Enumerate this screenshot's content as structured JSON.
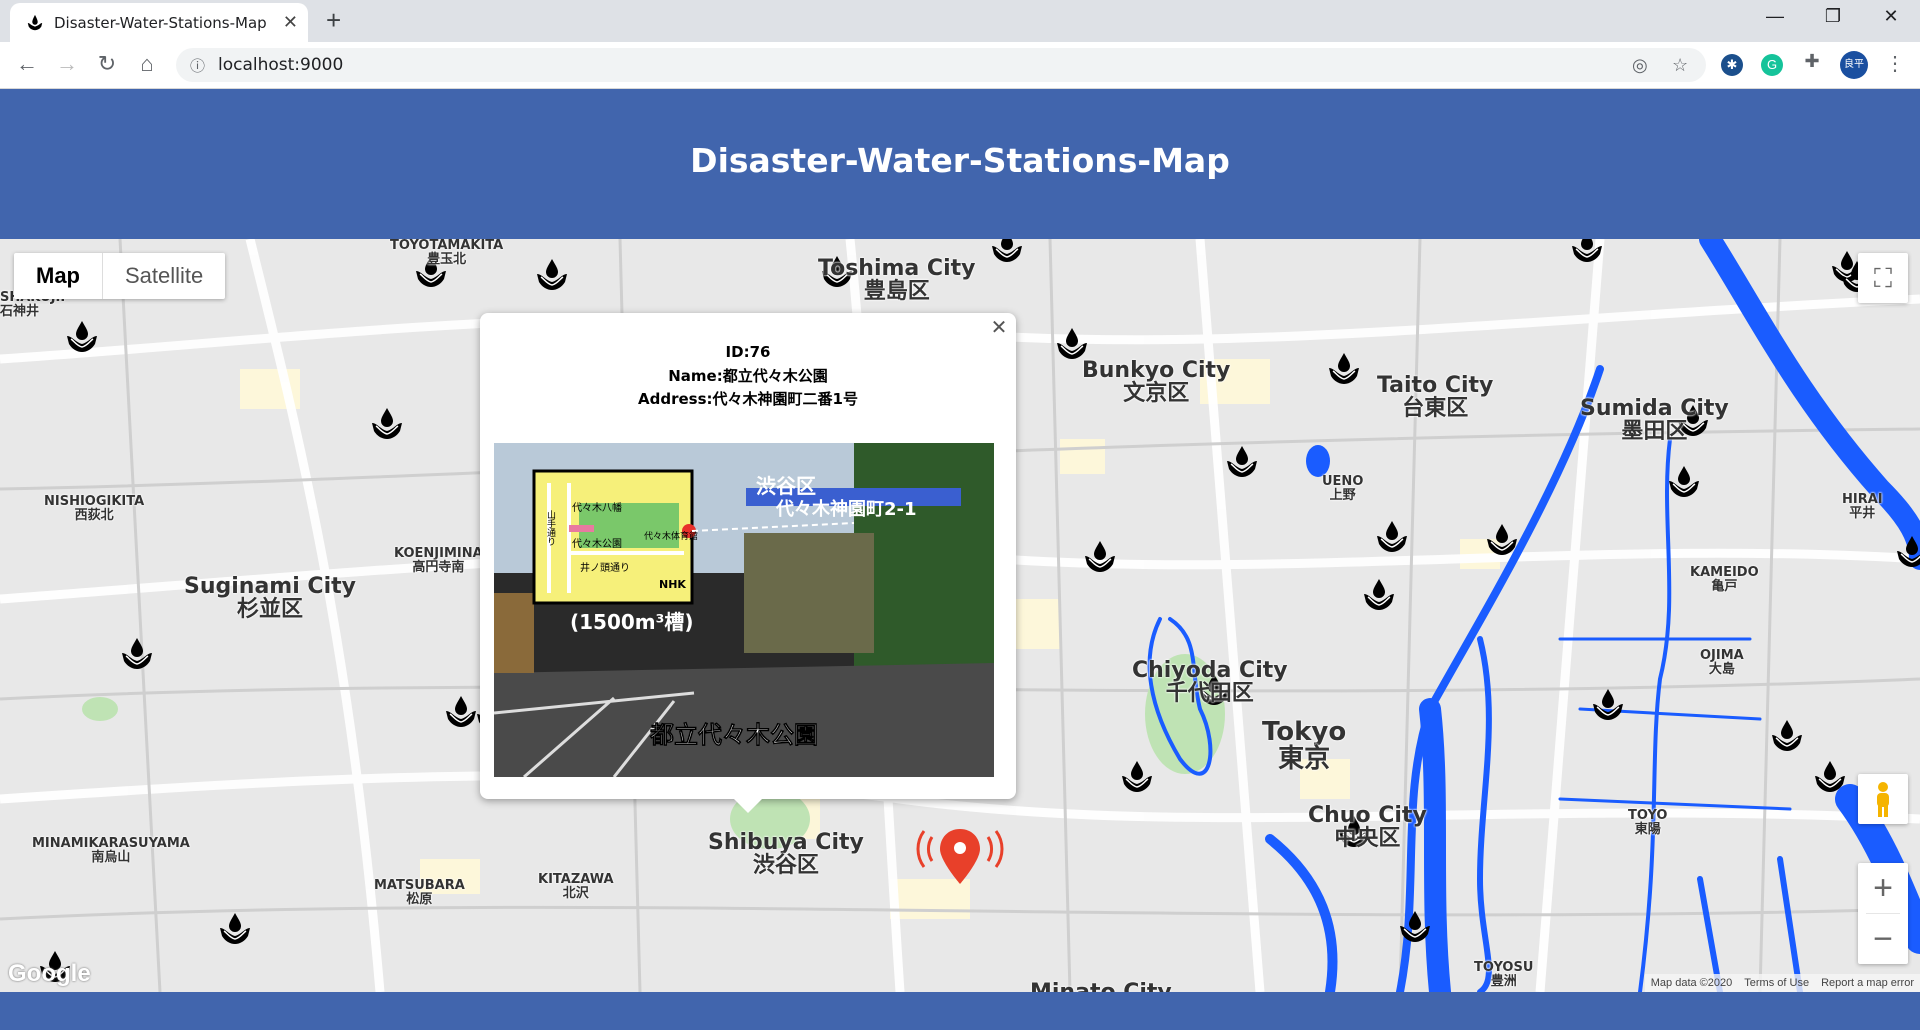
{
  "browser": {
    "tab_title": "Disaster-Water-Stations-Map",
    "url": "localhost:9000",
    "profile_initials": "良平"
  },
  "header": {
    "title": "Disaster-Water-Stations-Map"
  },
  "map": {
    "type_buttons": {
      "map": "Map",
      "satellite": "Satellite"
    },
    "google": "Google",
    "attribution": {
      "data": "Map data ©2020",
      "terms": "Terms of Use",
      "report": "Report a map error"
    },
    "labels": {
      "toyotamakita": "TOYOTAMAKITA",
      "toyotamakita_jp": "豊玉北",
      "toshima": "Toshima City",
      "toshima_jp": "豊島区",
      "shakujii": "SHAKUJII",
      "shakujii_jp": "石神井",
      "bunkyo": "Bunkyo City",
      "bunkyo_jp": "文京区",
      "taito": "Taito City",
      "taito_jp": "台東区",
      "sumida": "Sumida City",
      "sumida_jp": "墨田区",
      "ueno": "UENO",
      "ueno_jp": "上野",
      "hirai": "HIRAI",
      "hirai_jp": "平井",
      "nishiogikita": "NISHIOGIKITA",
      "nishiogikita_jp": "西荻北",
      "koenjimina": "KOENJIMINA",
      "koenjimina_jp": "高円寺南",
      "suginami": "Suginami City",
      "suginami_jp": "杉並区",
      "kameido": "KAMEIDO",
      "kameido_jp": "亀戸",
      "ojima": "OJIMA",
      "ojima_jp": "大島",
      "chiyoda": "Chiyoda City",
      "chiyoda_jp": "千代田区",
      "tokyo": "Tokyo",
      "tokyo_jp": "東京",
      "chuo": "Chuo City",
      "chuo_jp": "中央区",
      "toyo": "TOYO",
      "toyo_jp": "東陽",
      "minamikarasuyama": "MINAMIKARASUYAMA",
      "minamikarasuyama_jp": "南烏山",
      "shibuya": "Shibuya City",
      "shibuya_jp": "渋谷区",
      "matsubara": "MATSUBARA",
      "matsubara_jp": "松原",
      "kitazawa": "KITAZAWA",
      "kitazawa_jp": "北沢",
      "toyosu": "TOYOSU",
      "toyosu_jp": "豊洲",
      "minato": "Minato City"
    }
  },
  "infowindow": {
    "id_line": "ID:76",
    "name_line": "Name:都立代々木公園",
    "address_line": "Address:代々木神園町二番1号",
    "photo": {
      "ward": "渋谷区",
      "address": "代々木神園町2-1",
      "tank": "(1500m³槽)",
      "caption": "都立代々木公園",
      "inset": {
        "yamate": "山手通り",
        "hachiman": "代々木八幡",
        "koen": "代々木公園",
        "inokashira": "井ノ頭通り",
        "taiikukan": "代々木体育館",
        "nhk": "NHK"
      }
    }
  },
  "colors": {
    "header": "#4165ad",
    "water": "#1a5cff",
    "marker": "#e8402a"
  }
}
